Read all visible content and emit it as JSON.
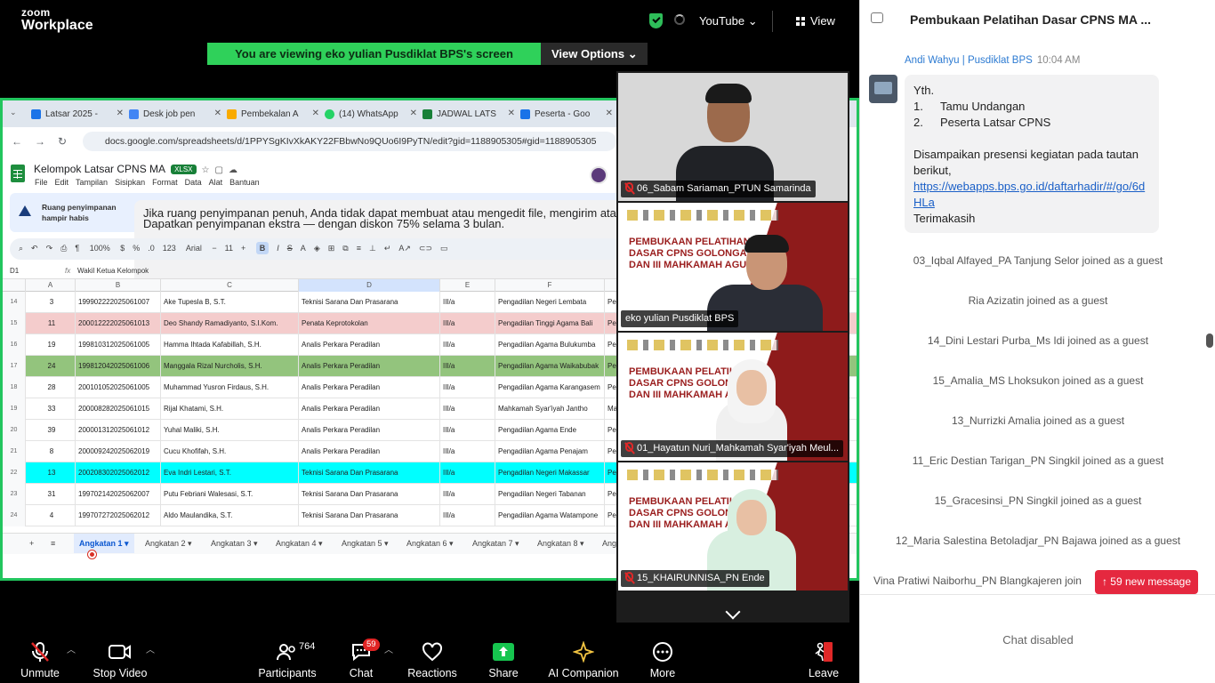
{
  "topbar": {
    "logo_line1": "zoom",
    "logo_line2": "Workplace",
    "youtube": "YouTube ⌄",
    "view": "View"
  },
  "banner": {
    "text": "You are viewing  eko yulian Pusdiklat BPS's screen",
    "view_options": "View Options ⌄"
  },
  "browser": {
    "tabs": [
      {
        "label": "Latsar 2025 - ",
        "icon_color": "#1a73e8"
      },
      {
        "label": "Desk job pen",
        "icon_color": "#4285f4"
      },
      {
        "label": "Pembekalan A",
        "icon_color": "#f9ab00"
      },
      {
        "label": "(14) WhatsApp",
        "icon_color": "#25d366"
      },
      {
        "label": "JADWAL LATS",
        "icon_color": "#188038"
      },
      {
        "label": "Peserta - Goo",
        "icon_color": "#1a73e8"
      }
    ],
    "url": "docs.google.com/spreadsheets/d/1PPYSgKIvXkAKY22FBbwNo9QUo6I9PyTN/edit?gid=1188905305#gid=1188905305"
  },
  "sheet": {
    "title": "Kelompok Latsar CPNS MA",
    "badge": "XLSX",
    "menus": [
      "File",
      "Edit",
      "Tampilan",
      "Sisipkan",
      "Format",
      "Data",
      "Alat",
      "Bantuan"
    ],
    "alert_title": "Ruang penyimpanan hampir habis",
    "alert_line1": "Jika ruang penyimpanan penuh, Anda tidak dapat membuat atau mengedit file, mengirim atau menerima email di Gmail, atau mencadangkan",
    "alert_line2": "Dapatkan penyimpanan ekstra — dengan diskon 75% selama 3 bulan.",
    "zoom": "100%",
    "font": "Arial",
    "font_size": "11",
    "cell_ref": "D1",
    "formula": "Wakil Ketua Kelompok",
    "columns": [
      "A",
      "B",
      "C",
      "D",
      "E",
      "F"
    ],
    "rows": [
      {
        "n": "14",
        "a": "3",
        "b": "199902222025061007",
        "c": "Ake Tupesla B, S.T.",
        "d": "Teknisi Sarana Dan Prasarana",
        "e": "III/a",
        "f": "Pengadilan Negeri Lembata",
        "g": "Per",
        "bg": "#ffffff"
      },
      {
        "n": "15",
        "a": "11",
        "b": "200012222025061013",
        "c": "Deo Shandy Ramadiyanto, S.I.Kom.",
        "d": "Penata Keprotokolan",
        "e": "III/a",
        "f": "Pengadilan Tinggi Agama Bali",
        "g": "Per Bal",
        "bg": "#f4cccc"
      },
      {
        "n": "16",
        "a": "19",
        "b": "199810312025061005",
        "c": "Hamma Ihtada Kafabillah, S.H.",
        "d": "Analis Perkara Peradilan",
        "e": "III/a",
        "f": "Pengadilan Agama Bulukumba",
        "g": "Per Bul",
        "bg": "#ffffff"
      },
      {
        "n": "17",
        "a": "24",
        "b": "199812042025061006",
        "c": "Manggala Rizal Nurcholis, S.H.",
        "d": "Analis Perkara Peradilan",
        "e": "III/a",
        "f": "Pengadilan Agama Waikabubak",
        "g": "Per Wa",
        "bg": "#93c47d"
      },
      {
        "n": "18",
        "a": "28",
        "b": "200101052025061005",
        "c": "Muhammad Yusron Firdaus, S.H.",
        "d": "Analis Perkara Peradilan",
        "e": "III/a",
        "f": "Pengadilan Agama Karangasem",
        "g": "Per Kar",
        "bg": "#ffffff"
      },
      {
        "n": "19",
        "a": "33",
        "b": "200008282025061015",
        "c": "Rijal Khatami, S.H.",
        "d": "Analis Perkara Peradilan",
        "e": "III/a",
        "f": "Mahkamah Syar'iyah Jantho",
        "g": "Ma Jan",
        "bg": "#ffffff"
      },
      {
        "n": "20",
        "a": "39",
        "b": "200001312025061012",
        "c": "Yuhal Maliki, S.H.",
        "d": "Analis Perkara Peradilan",
        "e": "III/a",
        "f": "Pengadilan Agama Ende",
        "g": "Per",
        "bg": "#ffffff"
      },
      {
        "n": "21",
        "a": "8",
        "b": "200009242025062019",
        "c": "Cucu Khofifah, S.H.",
        "d": "Analis Perkara Peradilan",
        "e": "III/a",
        "f": "Pengadilan Agama Penajam",
        "g": "Per",
        "bg": "#ffffff"
      },
      {
        "n": "22",
        "a": "13",
        "b": "200208302025062012",
        "c": "Eva Indri Lestari, S.T.",
        "d": "Teknisi Sarana Dan Prasarana",
        "e": "III/a",
        "f": "Pengadilan Negeri Makassar",
        "g": "Per Ma",
        "bg": "#00ffff"
      },
      {
        "n": "23",
        "a": "31",
        "b": "199702142025062007",
        "c": "Putu Febriani Walesasi, S.T.",
        "d": "Teknisi Sarana Dan Prasarana",
        "e": "III/a",
        "f": "Pengadilan Negeri Tabanan",
        "g": "Per",
        "bg": "#ffffff"
      },
      {
        "n": "24",
        "a": "4",
        "b": "199707272025062012",
        "c": "Aldo Maulandika, S.T.",
        "d": "Teknisi Sarana Dan Prasarana",
        "e": "III/a",
        "f": "Pengadilan Agama Watampone",
        "g": "Per Wa",
        "bg": "#ffffff"
      }
    ],
    "sheet_tabs": [
      "Angkatan 1",
      "Angkatan 2",
      "Angkatan 3",
      "Angkatan 4",
      "Angkatan 5",
      "Angkatan 6",
      "Angkatan 7",
      "Angkatan 8",
      "Ang"
    ]
  },
  "videos": [
    {
      "name": "06_Sabam Sariaman_PTUN Samarinda",
      "muted": true
    },
    {
      "name": "eko yulian Pusdiklat BPS",
      "muted": false,
      "slide_title": "PEMBUKAAN PELATIHAN DASAR CPNS GOLONGAN II DAN III MAHKAMAH AGUNG RI"
    },
    {
      "name": "01_Hayatun Nuri_Mahkamah Syar'iyah Meul...",
      "muted": true,
      "slide_title": "PEMBUKAAN PELATIHAN DASAR CPNS GOLONGAN II DAN III MAHKAMAH AGUNG RI"
    },
    {
      "name": "15_KHAIRUNNISA_PN Ende",
      "muted": true,
      "slide_title": "PEMBUKAAN PELATIHAN DASAR CPNS GOLONGAN II DAN III MAHKAMAH AGUNG RI"
    }
  ],
  "toolbar": {
    "unmute": "Unmute",
    "stop_video": "Stop Video",
    "participants": "Participants",
    "participants_count": "764",
    "chat": "Chat",
    "chat_badge": "59",
    "reactions": "Reactions",
    "share": "Share",
    "ai": "AI Companion",
    "more": "More",
    "leave": "Leave"
  },
  "chat": {
    "title": "Pembukaan Pelatihan Dasar CPNS MA ...",
    "sender": "Andi Wahyu | Pusdiklat BPS",
    "time": "10:04 AM",
    "msg_greeting": "Yth.",
    "msg_item1_n": "1.",
    "msg_item1": "Tamu Undangan",
    "msg_item2_n": "2.",
    "msg_item2": "Peserta Latsar CPNS",
    "msg_body": "Disampaikan presensi kegiatan pada tautan berikut,",
    "msg_link": "https://webapps.bps.go.id/daftarhadir/#/go/6dHLa",
    "msg_thanks": "Terimakasih",
    "joins": [
      "03_Iqbal Alfayed_PA Tanjung Selor joined as a guest",
      "Ria Azizatin joined as a guest",
      "14_Dini Lestari Purba_Ms Idi joined as a guest",
      "15_Amalia_MS Lhoksukon joined as a guest",
      "13_Nurrizki Amalia joined as a guest",
      "11_Eric Destian Tarigan_PN Singkil joined as a guest",
      "15_Gracesinsi_PN Singkil joined as a guest",
      "12_Maria Salestina Betoladjar_PN Bajawa joined as a guest",
      "Vina Pratiwi Naiborhu_PN Blangkajeren join"
    ],
    "new_messages": "↑ 59 new message",
    "disabled": "Chat disabled"
  }
}
